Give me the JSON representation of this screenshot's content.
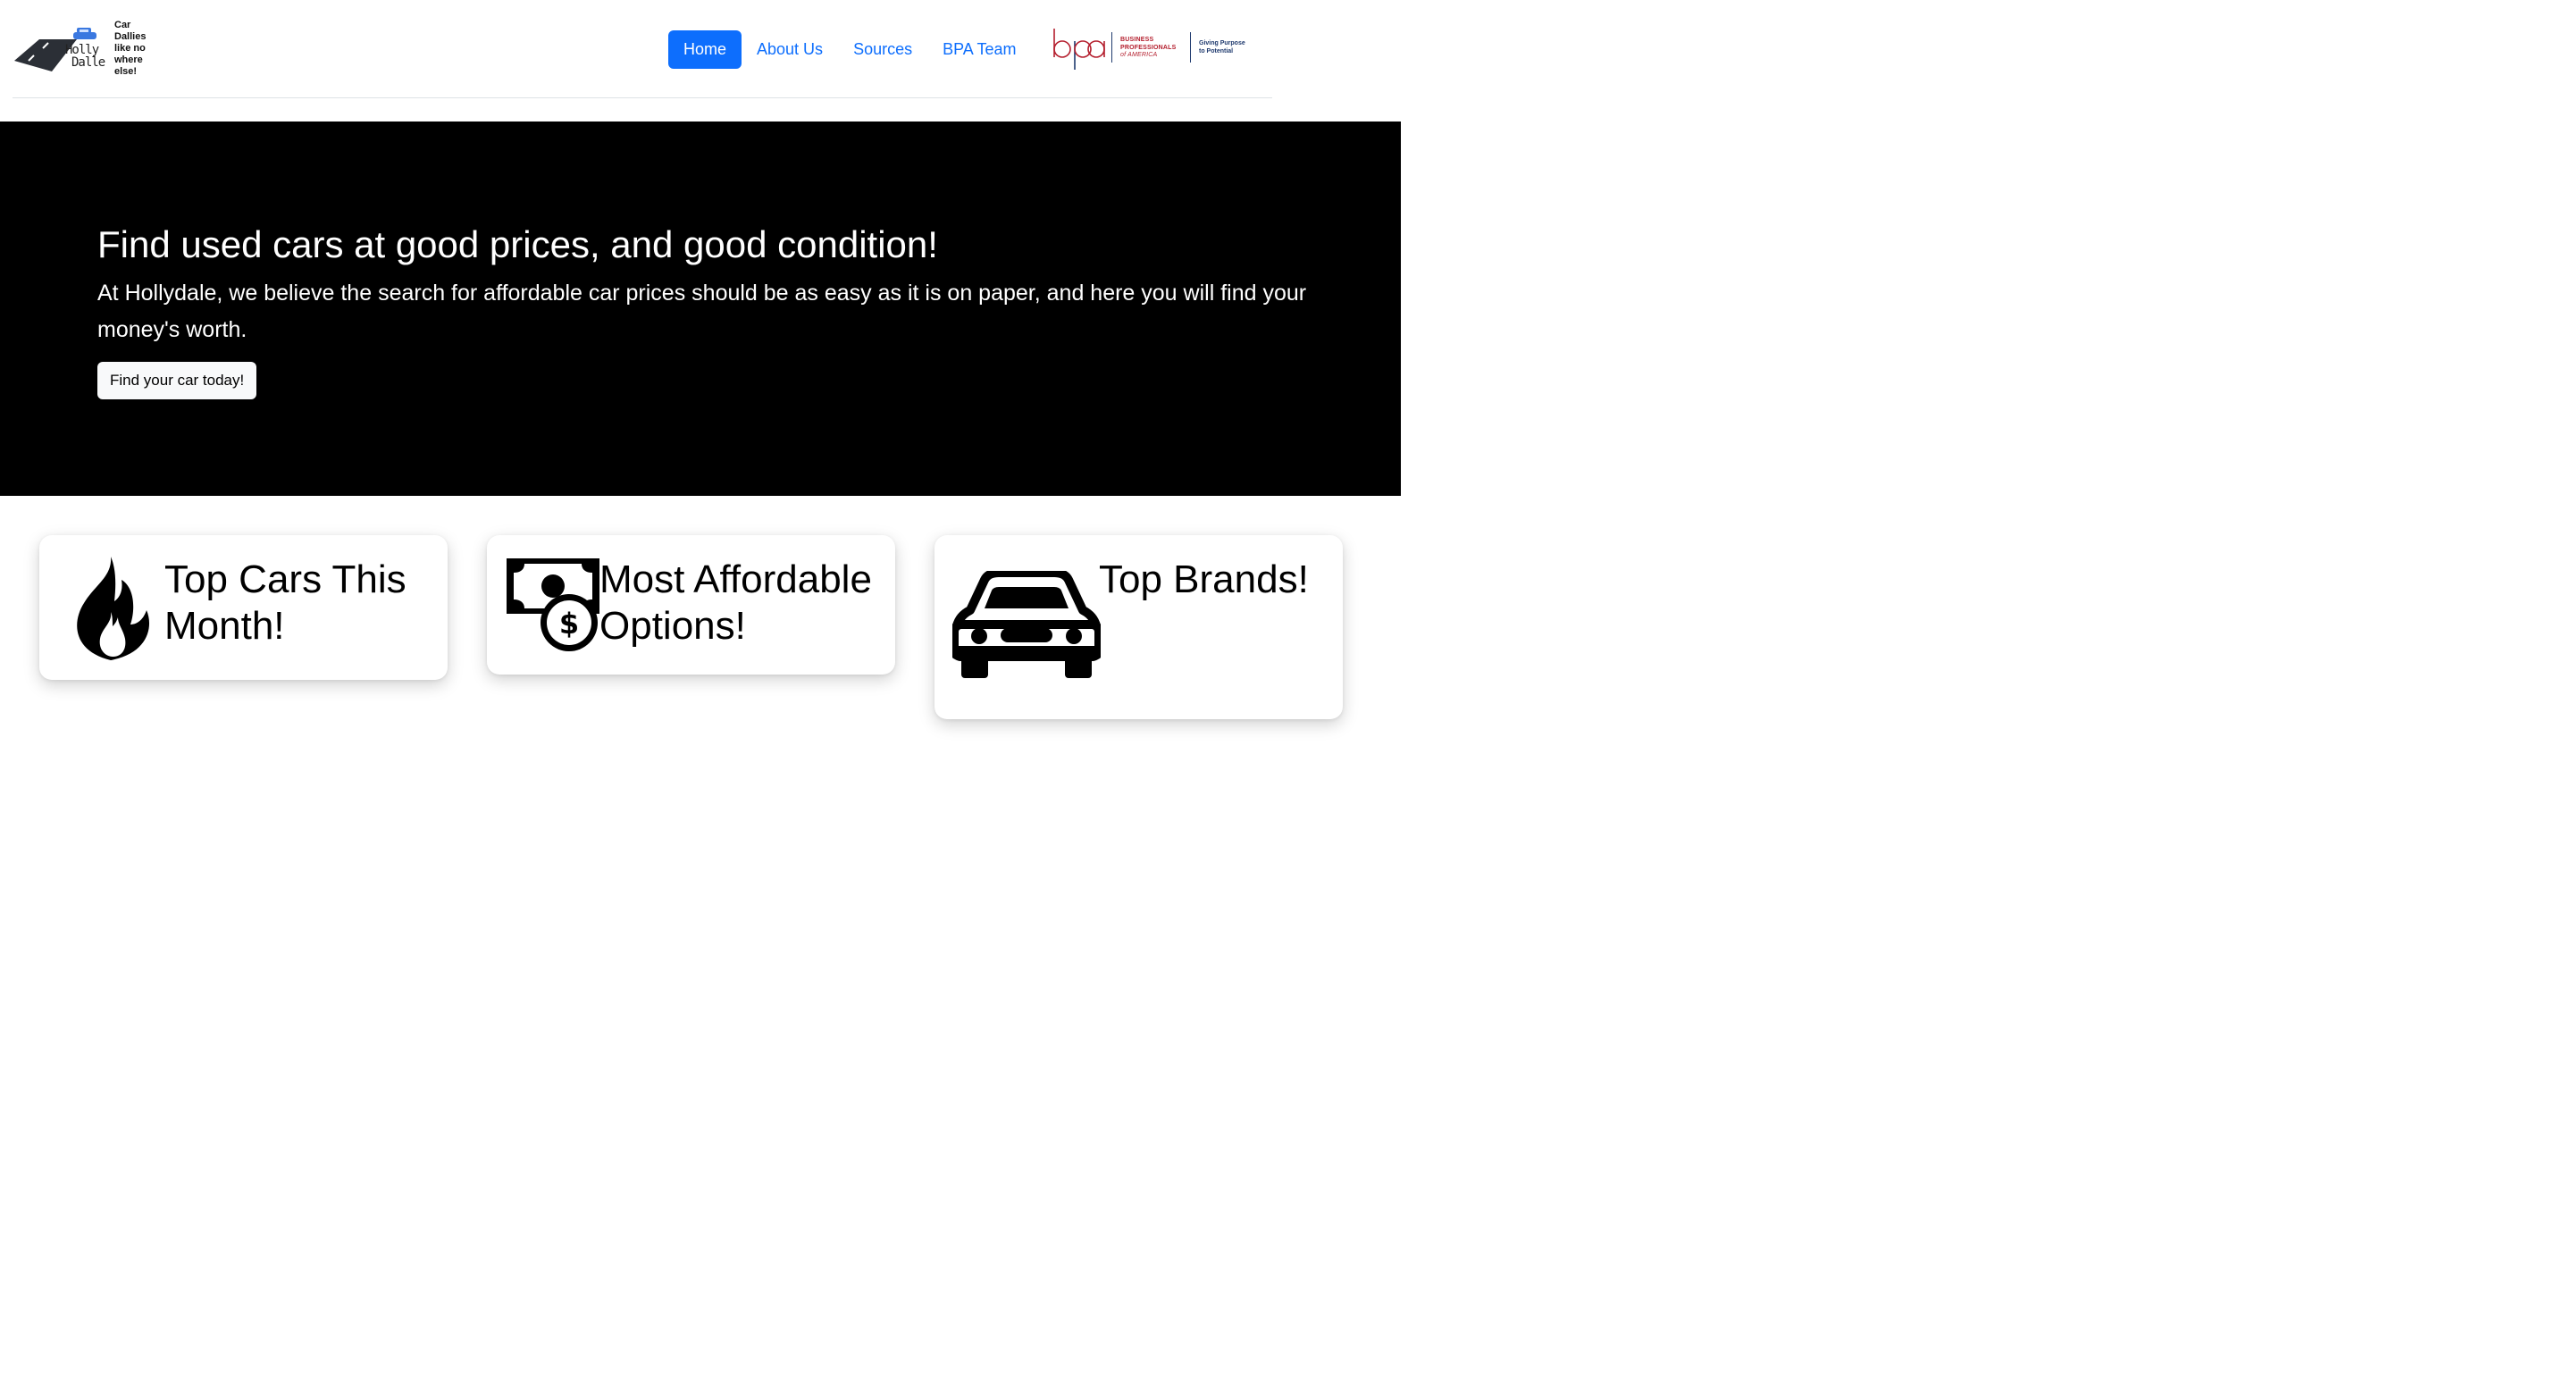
{
  "brand": {
    "logo_line1": "Holly",
    "logo_line2": "Dalle",
    "tagline": "Car Dallies like no where else!"
  },
  "nav": {
    "items": [
      {
        "label": "Home",
        "active": true
      },
      {
        "label": "About Us",
        "active": false
      },
      {
        "label": "Sources",
        "active": false
      },
      {
        "label": "BPA Team",
        "active": false
      }
    ]
  },
  "partner": {
    "mark": "bpa",
    "org_line1": "BUSINESS",
    "org_line2": "PROFESSIONALS",
    "org_line3": "of AMERICA",
    "slogan_line1": "Giving Purpose",
    "slogan_line2": "to Potential"
  },
  "hero": {
    "title": "Find used cars at good prices, and good condition!",
    "lead": "At Hollydale, we believe the search for affordable car prices should be as easy as it is on paper, and here you will find your money's worth.",
    "cta_label": "Find your car today!"
  },
  "cards": [
    {
      "icon": "fire-icon",
      "title": "Top Cars This Month!"
    },
    {
      "icon": "cash-icon",
      "title": "Most Affordable Options!"
    },
    {
      "icon": "car-icon",
      "title": "Top Brands!"
    }
  ],
  "colors": {
    "primary": "#0d6efd",
    "hero_bg": "#000000",
    "bpa_red": "#b41e2d",
    "bpa_navy": "#1f3a6e"
  }
}
